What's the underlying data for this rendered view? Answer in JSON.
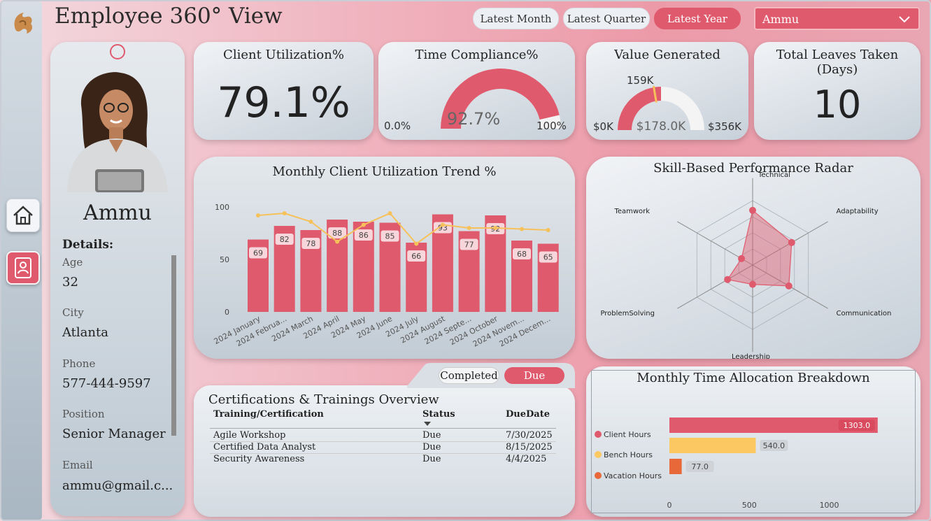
{
  "header": {
    "title": "Employee 360° View",
    "periods": [
      "Latest Month",
      "Latest Quarter",
      "Latest Year"
    ],
    "active_period": "Latest Year",
    "employee_select": "Ammu"
  },
  "profile": {
    "name": "Ammu",
    "details_label": "Details:",
    "fields": [
      {
        "label": "Age",
        "value": "32"
      },
      {
        "label": "City",
        "value": "Atlanta"
      },
      {
        "label": "Phone",
        "value": "577-444-9597"
      },
      {
        "label": "Position",
        "value": "Senior Manager"
      },
      {
        "label": "Email",
        "value": "ammu@gmail.c..."
      }
    ]
  },
  "kpis": {
    "client_utilization": {
      "title": "Client Utilization%",
      "value": "79.1%"
    },
    "time_compliance": {
      "title": "Time Compliance%",
      "value": "92.7%",
      "min": "0.0%",
      "max": "100%",
      "fraction": 0.927
    },
    "value_generated": {
      "title": "Value Generated",
      "value": "$178.0K",
      "min": "$0K",
      "max": "$356K",
      "target": "159K",
      "fraction": 0.5,
      "target_fraction": 0.447
    },
    "leaves": {
      "title": "Total Leaves Taken (Days)",
      "value": "10"
    }
  },
  "colors": {
    "accent": "#e05a6d",
    "line": "#f7c15a",
    "bench": "#fcc862",
    "vacation": "#e8683a"
  },
  "chart_data": [
    {
      "type": "bar",
      "title": "Monthly Client Utilization Trend %",
      "categories": [
        "2024 January",
        "2024 Februa...",
        "2024 March",
        "2024 April",
        "2024 May",
        "2024 June",
        "2024 July",
        "2024 August",
        "2024 Septe...",
        "2024 October",
        "2024 Novem...",
        "2024 Decem..."
      ],
      "values": [
        69,
        82,
        78,
        88,
        86,
        85,
        66,
        93,
        77,
        92,
        68,
        65
      ],
      "line_values": [
        92,
        94,
        86,
        67,
        83,
        94,
        65,
        83,
        80,
        80,
        79,
        78
      ],
      "yticks": [
        0,
        50,
        100
      ],
      "ylim": [
        0,
        110
      ]
    },
    {
      "type": "radar",
      "title": "Skill-Based Performance Radar",
      "axes": [
        "Technical",
        "Adaptability",
        "Communication",
        "Leadership",
        "ProblemSolving",
        "Teamwork"
      ],
      "values": [
        0.85,
        0.7,
        0.65,
        0.3,
        0.45,
        0.2
      ]
    },
    {
      "type": "bar",
      "orientation": "horizontal",
      "title": "Monthly Time Allocation Breakdown",
      "categories": [
        "Client Hours",
        "Bench Hours",
        "Vacation Hours"
      ],
      "values": [
        1303.0,
        540.0,
        77.0
      ],
      "labels": [
        "1303.0",
        "540.0",
        "77.0"
      ],
      "xticks": [
        0,
        500,
        1000
      ],
      "xlim": [
        0,
        1400
      ]
    }
  ],
  "certifications": {
    "title": "Certifications & Trainings Overview",
    "toggle": [
      "Completed",
      "Due"
    ],
    "active": "Due",
    "columns": [
      "Training/Certification",
      "Status",
      "DueDate"
    ],
    "rows": [
      [
        "Agile Workshop",
        "Due",
        "7/30/2025"
      ],
      [
        "Certified Data Analyst",
        "Due",
        "8/15/2025"
      ],
      [
        "Security Awareness",
        "Due",
        "4/4/2025"
      ]
    ]
  }
}
